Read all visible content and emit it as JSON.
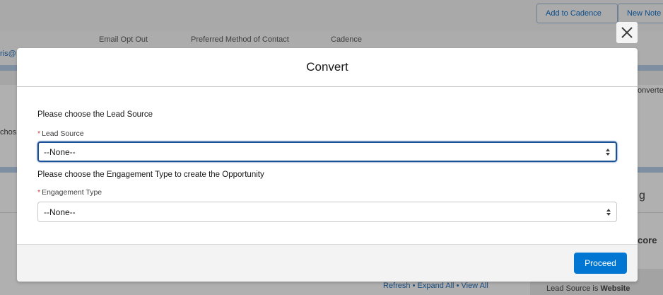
{
  "background": {
    "top_buttons": {
      "add_to_cadence": "Add to Cadence",
      "new_note": "New Note"
    },
    "field_labels": {
      "email_opt_out": "Email Opt Out",
      "preferred_method": "Preferred Method of Contact",
      "cadence": "Cadence"
    },
    "fragments": {
      "email": "ris@",
      "converted": "onverte",
      "choose": "chos",
      "g": "g",
      "core": "core"
    },
    "related_links": {
      "refresh": "Refresh",
      "expand_all": "Expand All",
      "view_all": "View All",
      "separator": "•"
    },
    "lead_source_note": {
      "prefix": "Lead Source is ",
      "value": "Website"
    }
  },
  "modal": {
    "title": "Convert",
    "lead_source_prompt": "Please choose the Lead Source",
    "lead_source_label": "Lead Source",
    "lead_source_value": "--None--",
    "engagement_prompt": "Please choose the Engagement Type to create the Opportunity",
    "engagement_label": "Engagement Type",
    "engagement_value": "--None--",
    "required_mark": "*",
    "proceed_label": "Proceed"
  },
  "colors": {
    "brand": "#0176d3",
    "focus_border": "#1b5297",
    "required": "#c23934",
    "overlay": "#a9a9a9"
  }
}
